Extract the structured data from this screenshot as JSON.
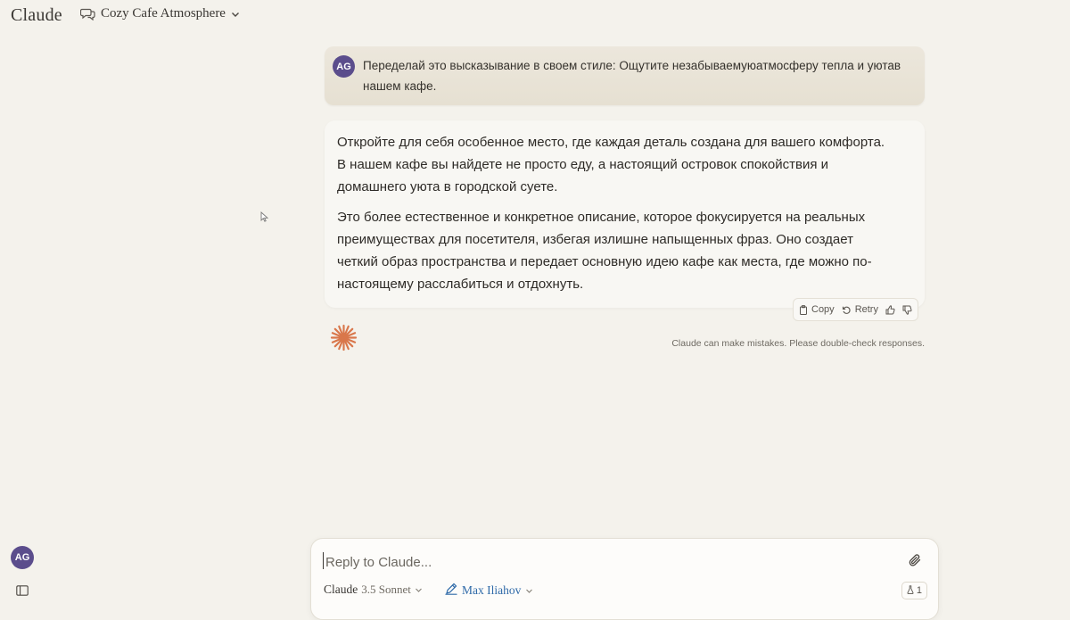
{
  "app": {
    "name": "Claude"
  },
  "chat": {
    "title": "Cozy Cafe Atmosphere"
  },
  "user": {
    "initials": "AG"
  },
  "messages": {
    "user_text": "Переделай это высказывание в своем стиле: Ощутите незабываемуюатмосферу тепла и уютав нашем кафе.",
    "assistant_p1": "Откройте для себя особенное место, где каждая деталь создана для вашего комфорта. В нашем кафе вы найдете не просто еду, а настоящий островок спокойствия и домашнего уюта в городской суете.",
    "assistant_p2": "Это более естественное и конкретное описание, которое фокусируется на реальных преимуществах для посетителя, избегая излишне напыщенных фраз. Оно создает четкий образ пространства и передает основную идею кафе как места, где можно по-настоящему расслабиться и отдохнуть."
  },
  "actions": {
    "copy": "Copy",
    "retry": "Retry"
  },
  "disclaimer": "Claude can make mistakes. Please double-check responses.",
  "composer": {
    "placeholder": "Reply to Claude...",
    "model_name": "Claude",
    "model_version": "3.5 Sonnet",
    "style_name": "Max Iliahov",
    "count": "1"
  },
  "colors": {
    "accent": "#d9774b",
    "avatar": "#5b4d8c",
    "link": "#2f6aa8"
  }
}
